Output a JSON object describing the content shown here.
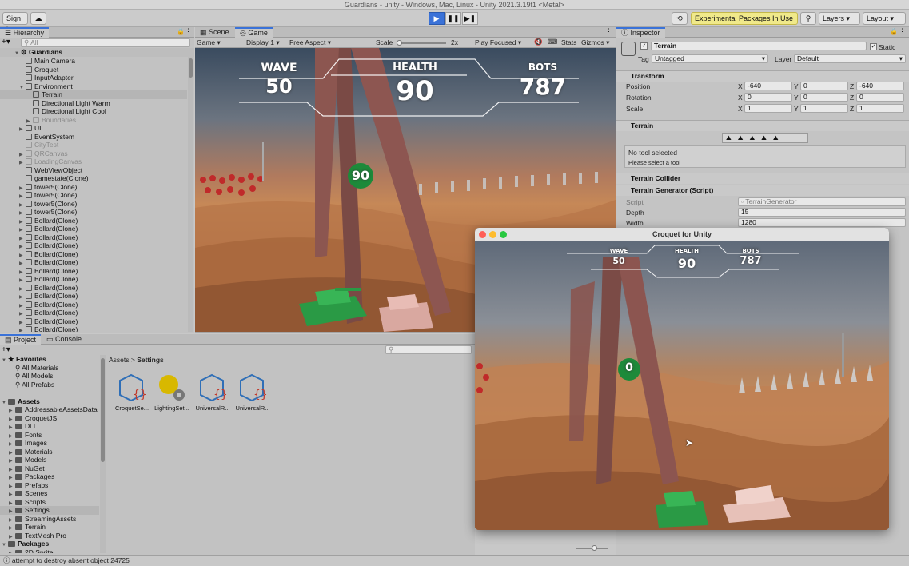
{
  "window_title": "Guardians - unity - Windows, Mac, Linux - Unity 2021.3.19f1 <Metal>",
  "toolbar": {
    "sign_in": "Sign in",
    "cloud_icon": "cloud-icon",
    "experimental": "Experimental Packages In Use",
    "layers": "Layers",
    "layout": "Layout"
  },
  "hierarchy": {
    "tab": "Hierarchy",
    "search_placeholder": "All",
    "scene": "Guardians",
    "items": [
      {
        "label": "Main Camera",
        "indent": 2,
        "muted": false
      },
      {
        "label": "Croquet",
        "indent": 2,
        "muted": false
      },
      {
        "label": "InputAdapter",
        "indent": 2,
        "muted": false
      },
      {
        "label": "Environment",
        "indent": 2,
        "muted": false
      },
      {
        "label": "Terrain",
        "indent": 3,
        "muted": false
      },
      {
        "label": "Directional Light Warm",
        "indent": 3,
        "muted": false
      },
      {
        "label": "Directional Light Cool",
        "indent": 3,
        "muted": false
      },
      {
        "label": "Boundaries",
        "indent": 3,
        "muted": true
      },
      {
        "label": "UI",
        "indent": 2,
        "muted": false
      },
      {
        "label": "EventSystem",
        "indent": 2,
        "muted": false
      },
      {
        "label": "CityTest",
        "indent": 2,
        "muted": true
      },
      {
        "label": "QRCanvas",
        "indent": 2,
        "muted": true
      },
      {
        "label": "LoadingCanvas",
        "indent": 2,
        "muted": true
      },
      {
        "label": "WebViewObject",
        "indent": 2,
        "muted": false
      },
      {
        "label": "gamestate(Clone)",
        "indent": 2,
        "muted": false
      },
      {
        "label": "tower5(Clone)",
        "indent": 2,
        "muted": false
      },
      {
        "label": "tower5(Clone)",
        "indent": 2,
        "muted": false
      },
      {
        "label": "tower5(Clone)",
        "indent": 2,
        "muted": false
      },
      {
        "label": "tower5(Clone)",
        "indent": 2,
        "muted": false
      },
      {
        "label": "Bollard(Clone)",
        "indent": 2,
        "muted": false
      },
      {
        "label": "Bollard(Clone)",
        "indent": 2,
        "muted": false
      },
      {
        "label": "Bollard(Clone)",
        "indent": 2,
        "muted": false
      },
      {
        "label": "Bollard(Clone)",
        "indent": 2,
        "muted": false
      },
      {
        "label": "Bollard(Clone)",
        "indent": 2,
        "muted": false
      },
      {
        "label": "Bollard(Clone)",
        "indent": 2,
        "muted": false
      },
      {
        "label": "Bollard(Clone)",
        "indent": 2,
        "muted": false
      },
      {
        "label": "Bollard(Clone)",
        "indent": 2,
        "muted": false
      },
      {
        "label": "Bollard(Clone)",
        "indent": 2,
        "muted": false
      },
      {
        "label": "Bollard(Clone)",
        "indent": 2,
        "muted": false
      },
      {
        "label": "Bollard(Clone)",
        "indent": 2,
        "muted": false
      },
      {
        "label": "Bollard(Clone)",
        "indent": 2,
        "muted": false
      },
      {
        "label": "Bollard(Clone)",
        "indent": 2,
        "muted": false
      },
      {
        "label": "Bollard(Clone)",
        "indent": 2,
        "muted": false
      },
      {
        "label": "Bollard(Clone)",
        "indent": 2,
        "muted": false
      }
    ]
  },
  "scene_tabs": {
    "scene": "Scene",
    "game": "Game"
  },
  "game_toolbar": {
    "display_mode": "Game",
    "display": "Display 1",
    "aspect": "Free Aspect",
    "scale_label": "Scale",
    "scale_value": "2x",
    "play_mode": "Play Focused",
    "stats": "Stats",
    "gizmos": "Gizmos"
  },
  "hud": {
    "wave_label": "WAVE",
    "wave_value": "50",
    "health_label": "HEALTH",
    "health_value": "90",
    "bots_label": "BOTS",
    "bots_value": "787",
    "marker_value": "90"
  },
  "inspector": {
    "tab": "Inspector",
    "object_name": "Terrain",
    "static_label": "Static",
    "tag_label": "Tag",
    "tag_value": "Untagged",
    "layer_label": "Layer",
    "layer_value": "Default",
    "transform": {
      "title": "Transform",
      "position_label": "Position",
      "rotation_label": "Rotation",
      "scale_label": "Scale",
      "position": {
        "x": "-640",
        "y": "0",
        "z": "-640"
      },
      "rotation": {
        "x": "0",
        "y": "0",
        "z": "0"
      },
      "scale": {
        "x": "1",
        "y": "1",
        "z": "1"
      }
    },
    "terrain": {
      "title": "Terrain",
      "no_tool": "No tool selected",
      "hint": "Please select a tool"
    },
    "collider_title": "Terrain Collider",
    "generator": {
      "title": "Terrain Generator (Script)",
      "script_label": "Script",
      "script_value": "TerrainGenerator",
      "depth_label": "Depth",
      "depth_value": "15",
      "width_label": "Width",
      "width_value": "1280"
    }
  },
  "project": {
    "tab_project": "Project",
    "tab_console": "Console",
    "favorites": "Favorites",
    "fav_items": [
      "All Materials",
      "All Models",
      "All Prefabs"
    ],
    "assets": "Assets",
    "asset_folders": [
      "AddressableAssetsData",
      "CroquetJS",
      "DLL",
      "Fonts",
      "Images",
      "Materials",
      "Models",
      "NuGet",
      "Packages",
      "Prefabs",
      "Scenes",
      "Scripts",
      "Settings",
      "StreamingAssets",
      "Terrain",
      "TextMesh Pro"
    ],
    "packages": "Packages",
    "package_items": [
      "2D Sprite"
    ],
    "breadcrumb_root": "Assets",
    "breadcrumb_current": "Settings",
    "grid_items": [
      "CroquetSe...",
      "LightingSet...",
      "UniversalR...",
      "UniversalR..."
    ]
  },
  "croquet_window": {
    "title": "Croquet for Unity",
    "hud": {
      "wave_label": "WAVE",
      "wave_value": "50",
      "health_label": "HEALTH",
      "health_value": "90",
      "bots_label": "BOTS",
      "bots_value": "787",
      "marker_value": "0"
    }
  },
  "status": {
    "message": "attempt to destroy absent object 24725"
  },
  "colors": {
    "accent": "#3a72d8",
    "experimental": "#f0e98a",
    "selected_row": "#b5b5b5"
  }
}
